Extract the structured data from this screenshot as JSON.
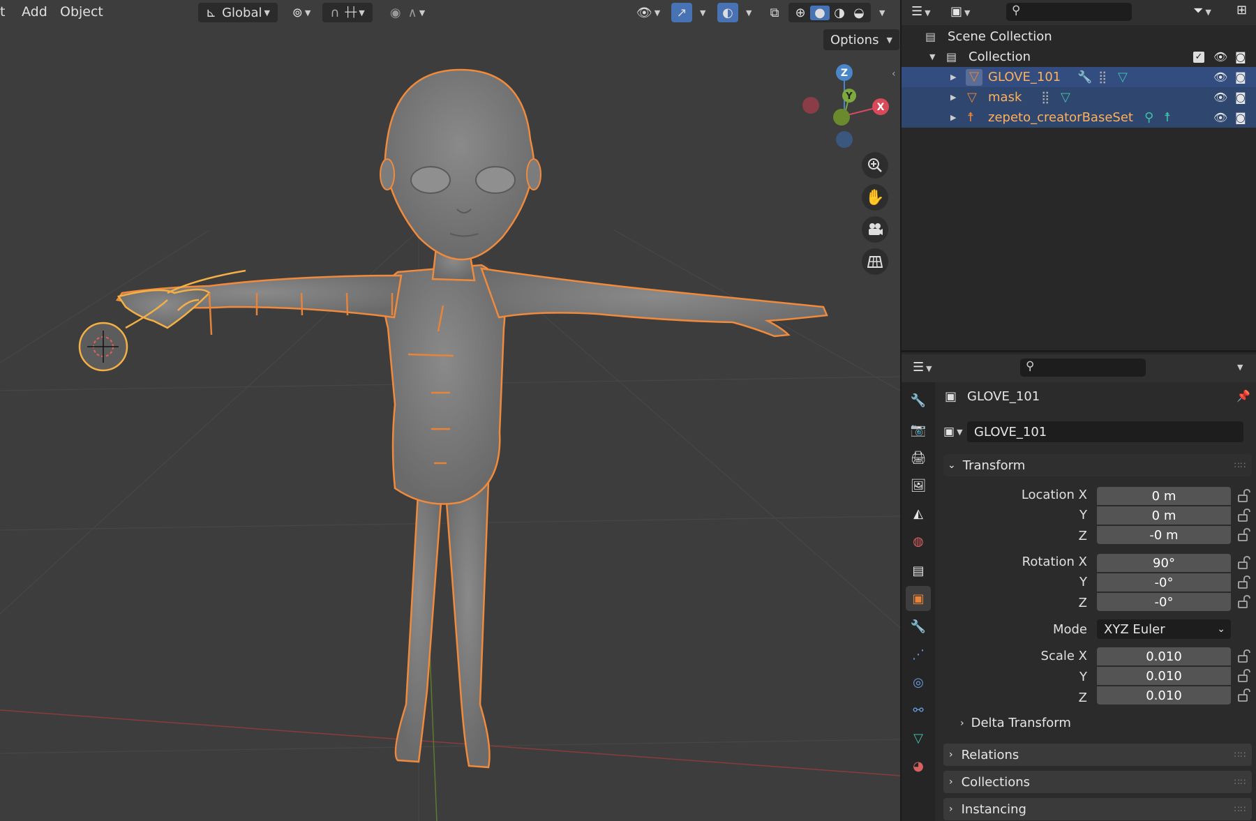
{
  "menu": {
    "item0": "t",
    "add": "Add",
    "object": "Object"
  },
  "toolbar": {
    "orientation": "Global",
    "options": "Options"
  },
  "gizmo": {
    "z": "Z",
    "y": "Y",
    "x": "X"
  },
  "nav_icons": [
    "zoom-icon",
    "hand-pan-icon",
    "camera-icon",
    "grid-ortho-icon"
  ],
  "outliner": {
    "scene_collection": "Scene Collection",
    "collection": "Collection",
    "objects": [
      {
        "name": "GLOVE_101"
      },
      {
        "name": "mask"
      },
      {
        "name": "zepeto_creatorBaseSet"
      }
    ]
  },
  "properties": {
    "object_name": "GLOVE_101",
    "datablock_name": "GLOVE_101",
    "transform": {
      "title": "Transform",
      "location_label": "Location X",
      "location": [
        "0 m",
        "0 m",
        "-0 m"
      ],
      "rotation_label": "Rotation X",
      "rotation": [
        "90°",
        "-0°",
        "-0°"
      ],
      "mode_label": "Mode",
      "mode": "XYZ Euler",
      "scale_label": "Scale X",
      "scale": [
        "0.010",
        "0.010",
        "0.010"
      ],
      "y": "Y",
      "z": "Z",
      "delta": "Delta Transform"
    },
    "panels": [
      "Relations",
      "Collections",
      "Instancing"
    ]
  },
  "colors": {
    "selection": "#334d80",
    "orange": "#e8843a",
    "outline": "#f08a3c"
  }
}
